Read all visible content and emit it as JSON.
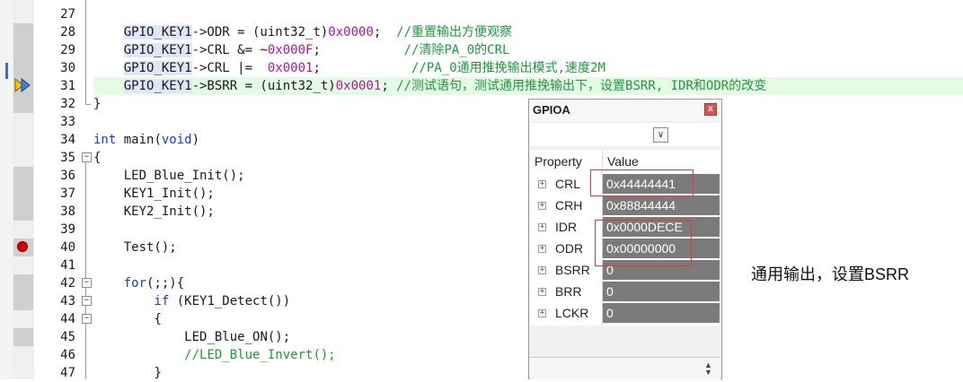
{
  "editor": {
    "line_numbers": [
      "27",
      "28",
      "29",
      "30",
      "31",
      "32",
      "33",
      "34",
      "35",
      "36",
      "37",
      "38",
      "39",
      "40",
      "41",
      "42",
      "43",
      "44",
      "45",
      "46",
      "47"
    ],
    "lines": {
      "l28": {
        "obj": "GPIO_KEY1",
        "rest": "->ODR = (uint32_t)",
        "num": "0x0000",
        "end": ";",
        "comment": "//重置输出方便观察"
      },
      "l29": {
        "obj": "GPIO_KEY1",
        "rest": "->CRL &= ~",
        "num": "0x000F",
        "end": ";",
        "comment": "//清除PA_0的CRL"
      },
      "l30": {
        "obj": "GPIO_KEY1",
        "rest": "->CRL |=  ",
        "num": "0x0001",
        "end": ";",
        "comment": "//PA_0通用推挽输出模式,速度2M"
      },
      "l31": {
        "obj": "GPIO_KEY1",
        "rest": "->BSRR = (uint32_t)",
        "num": "0x0001",
        "end": ";",
        "comment": "//测试语句，测试通用推挽输出下，设置BSRR, IDR和ODR的改变"
      },
      "l32": "}",
      "l34_kw1": "int",
      "l34_mid": " main(",
      "l34_kw2": "void",
      "l34_end": ")",
      "l35": "{",
      "l36": "LED_Blue_Init();",
      "l37": "KEY1_Init();",
      "l38": "KEY2_Init();",
      "l40": "Test();",
      "l42_kw": "for",
      "l42_rest": "(;;){",
      "l43_kw": "if",
      "l43_rest": " (KEY1_Detect())",
      "l44": "{",
      "l45": "LED_Blue_ON();",
      "l46": "//LED_Blue_Invert();",
      "l47": "}"
    }
  },
  "gpio_panel": {
    "title": "GPIOA",
    "close_label": "x",
    "dropdown_glyph": "∨",
    "col_property": "Property",
    "col_value": "Value",
    "registers": [
      {
        "name": "CRL",
        "value": "0x44444441"
      },
      {
        "name": "CRH",
        "value": "0x88844444"
      },
      {
        "name": "IDR",
        "value": "0x0000DECE"
      },
      {
        "name": "ODR",
        "value": "0x00000000"
      },
      {
        "name": "BSRR",
        "value": "0"
      },
      {
        "name": "BRR",
        "value": "0"
      },
      {
        "name": "LCKR",
        "value": "0"
      }
    ]
  },
  "annotation": "通用输出，设置BSRR",
  "colors": {
    "keyword": "#1a3bd6",
    "number": "#b5149c",
    "comment": "#1e9a3a",
    "current_line": "#e4fbe4",
    "breakpoint": "#d90000",
    "highlight_box": "#e03a3a"
  }
}
